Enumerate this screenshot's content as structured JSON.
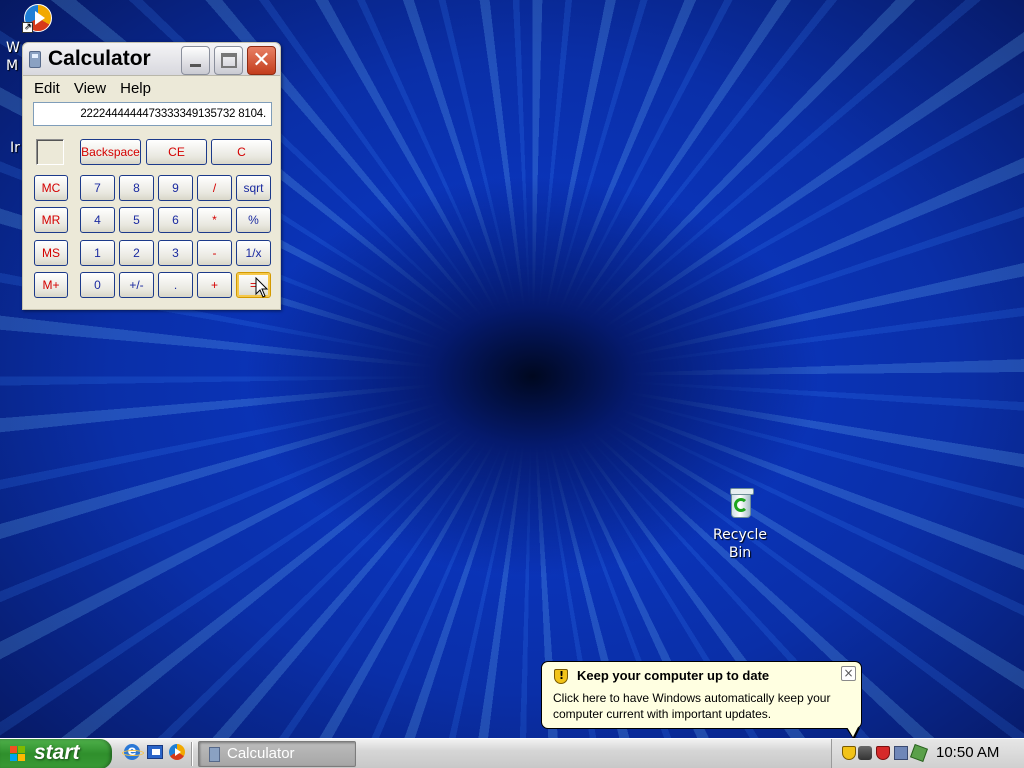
{
  "desktop": {
    "partial_icon_1": {
      "label_line1": "W",
      "label_line2": "M"
    },
    "partial_icon_2": {
      "label": "Ir"
    },
    "recycle_bin": {
      "label_line1": "Recycle",
      "label_line2": "Bin"
    }
  },
  "calculator": {
    "title": "Calculator",
    "menu": [
      "Edit",
      "View",
      "Help"
    ],
    "display_value": "2222444444473333349135732 8104.",
    "buttons": {
      "backspace": "Backspace",
      "ce": "CE",
      "c": "C",
      "mc": "MC",
      "mr": "MR",
      "ms": "MS",
      "mplus": "M+",
      "n7": "7",
      "n8": "8",
      "n9": "9",
      "div": "/",
      "sqrt": "sqrt",
      "n4": "4",
      "n5": "5",
      "n6": "6",
      "mul": "*",
      "pct": "%",
      "n1": "1",
      "n2": "2",
      "n3": "3",
      "sub": "-",
      "inv": "1/x",
      "n0": "0",
      "neg": "+/-",
      "dot": ".",
      "add": "+",
      "eq": "="
    },
    "colors": {
      "red_label": "#d40000",
      "blue_label": "#1a2aa0"
    }
  },
  "balloon": {
    "title": "Keep your computer up to date",
    "text": "Click here to have Windows automatically keep your computer current with important updates.",
    "close": "×"
  },
  "taskbar": {
    "start_label": "start",
    "task_button": "Calculator",
    "clock": "10:50 AM"
  },
  "icons": [
    "media-player-icon",
    "recycle-bin-icon",
    "calculator-icon",
    "shield-icon",
    "close-icon",
    "internet-explorer-icon",
    "show-desktop-icon",
    "network-icon",
    "security-icon",
    "computer-icon",
    "update-icon",
    "windows-flag-icon"
  ]
}
